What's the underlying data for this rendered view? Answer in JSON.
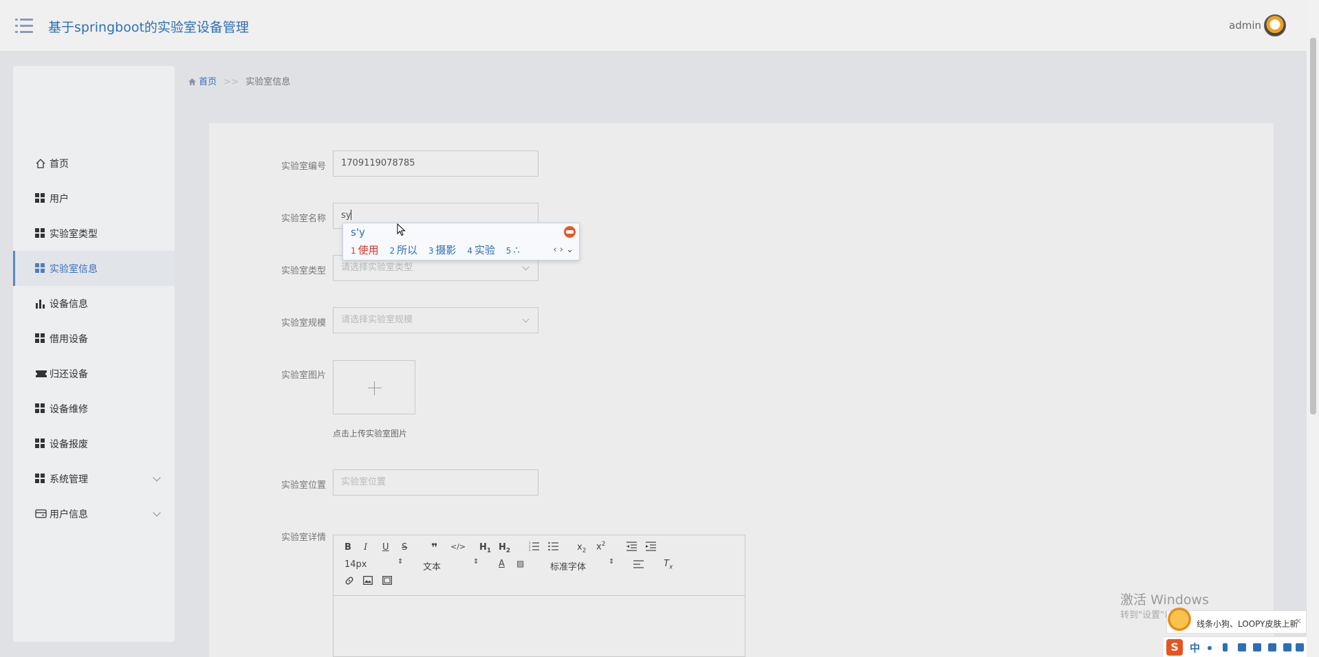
{
  "header": {
    "title": "基于springboot的实验室设备管理",
    "user": "admin"
  },
  "sidebar": {
    "items": [
      {
        "label": "首页",
        "icon": "home-icon"
      },
      {
        "label": "用户",
        "icon": "grid-icon"
      },
      {
        "label": "实验室类型",
        "icon": "grid-icon"
      },
      {
        "label": "实验室信息",
        "icon": "grid-icon",
        "active": true
      },
      {
        "label": "设备信息",
        "icon": "bar-chart-icon"
      },
      {
        "label": "借用设备",
        "icon": "grid-icon"
      },
      {
        "label": "归还设备",
        "icon": "ticket-icon"
      },
      {
        "label": "设备维修",
        "icon": "grid-icon"
      },
      {
        "label": "设备报废",
        "icon": "grid-icon"
      },
      {
        "label": "系统管理",
        "icon": "grid-icon",
        "expandable": true
      },
      {
        "label": "用户信息",
        "icon": "card-icon",
        "expandable": true
      }
    ]
  },
  "breadcrumb": {
    "home": "首页",
    "separator": ">>",
    "current": "实验室信息"
  },
  "form": {
    "lab_no_label": "实验室编号",
    "lab_no_value": "1709119078785",
    "lab_name_label": "实验室名称",
    "lab_name_value": "sy",
    "lab_type_label": "实验室类型",
    "lab_type_placeholder": "请选择实验室类型",
    "lab_scale_label": "实验室规模",
    "lab_scale_placeholder": "请选择实验室规模",
    "lab_image_label": "实验室图片",
    "lab_image_hint": "点击上传实验室图片",
    "lab_location_label": "实验室位置",
    "lab_location_placeholder": "实验室位置",
    "lab_detail_label": "实验室详情"
  },
  "editor": {
    "font_size": "14px",
    "header_select": "文本",
    "font_family": "标准字体"
  },
  "ime": {
    "pinyin": "s'y",
    "candidates": [
      {
        "num": "1",
        "text": "使用"
      },
      {
        "num": "2",
        "text": "所以"
      },
      {
        "num": "3",
        "text": "摄影"
      },
      {
        "num": "4",
        "text": "实验"
      },
      {
        "num": "5",
        "text": "∴"
      }
    ]
  },
  "watermark": {
    "title": "激活 Windows",
    "subtitle": "转到\"设置\"以激活 Windows。"
  },
  "notification": {
    "text": "线条小狗、LOOPY皮肤上新"
  },
  "tray": {
    "ime_mode": "中"
  },
  "colors": {
    "accent": "#2d6fb6",
    "active_bg": "#e1e5ea",
    "ime_highlight": "#d9342b"
  }
}
